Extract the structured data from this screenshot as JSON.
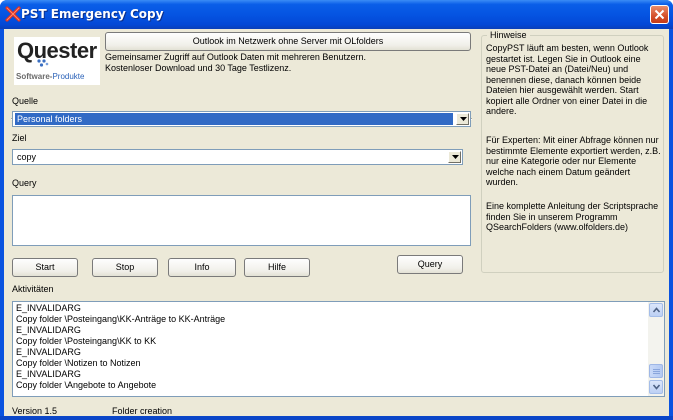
{
  "window": {
    "title": "PST Emergency Copy"
  },
  "logo": {
    "main": "Quester",
    "sub_bold": "Software-",
    "sub_rest": "Produkte"
  },
  "ad": {
    "button_label": "Outlook im Netzwerk ohne Server mit OLfolders",
    "text": "Gemeinsamer Zugriff auf Outlook Daten mit mehreren Benutzern. Kostenloser Download und 30 Tage Testlizenz."
  },
  "quelle": {
    "label": "Quelle",
    "value": "Personal folders"
  },
  "ziel": {
    "label": "Ziel",
    "value": "copy"
  },
  "query": {
    "label": "Query",
    "value": ""
  },
  "buttons": {
    "start": "Start",
    "stop": "Stop",
    "info": "Info",
    "hilfe": "Hilfe",
    "query": "Query"
  },
  "hinweise": {
    "title": "Hinweise",
    "paragraphs": [
      "CopyPST läuft am besten, wenn Outlook gestartet ist. Legen Sie in Outlook eine neue PST-Datei an (Datei/Neu) und benennen diese, danach können beide Dateien hier ausgewählt werden. Start kopiert alle Ordner von einer Datei in die andere.",
      "Für Experten: Mit einer Abfrage können nur bestimmte Elemente exportiert werden, z.B. nur eine Kategorie oder nur Elemente welche nach einem Datum geändert wurden.",
      "Eine komplette Anleitung der Scriptsprache finden Sie in unserem Programm QSearchFolders (www.olfolders.de)"
    ]
  },
  "aktivitaeten": {
    "label": "Aktivitäten",
    "lines": [
      "E_INVALIDARG",
      "Copy folder \\Posteingang\\KK-Anträge to KK-Anträge",
      "E_INVALIDARG",
      "Copy folder \\Posteingang\\KK to KK",
      "E_INVALIDARG",
      "Copy folder \\Notizen to Notizen",
      "E_INVALIDARG",
      "Copy folder \\Angebote to Angebote"
    ]
  },
  "status": {
    "version": "Version 1.5",
    "message": "Folder creation"
  },
  "icons": {
    "title": "red-x-app-icon",
    "close": "close-icon",
    "dropdown": "chevron-down-icon",
    "scroll_up": "scroll-up-icon",
    "scroll_down": "scroll-down-icon"
  }
}
